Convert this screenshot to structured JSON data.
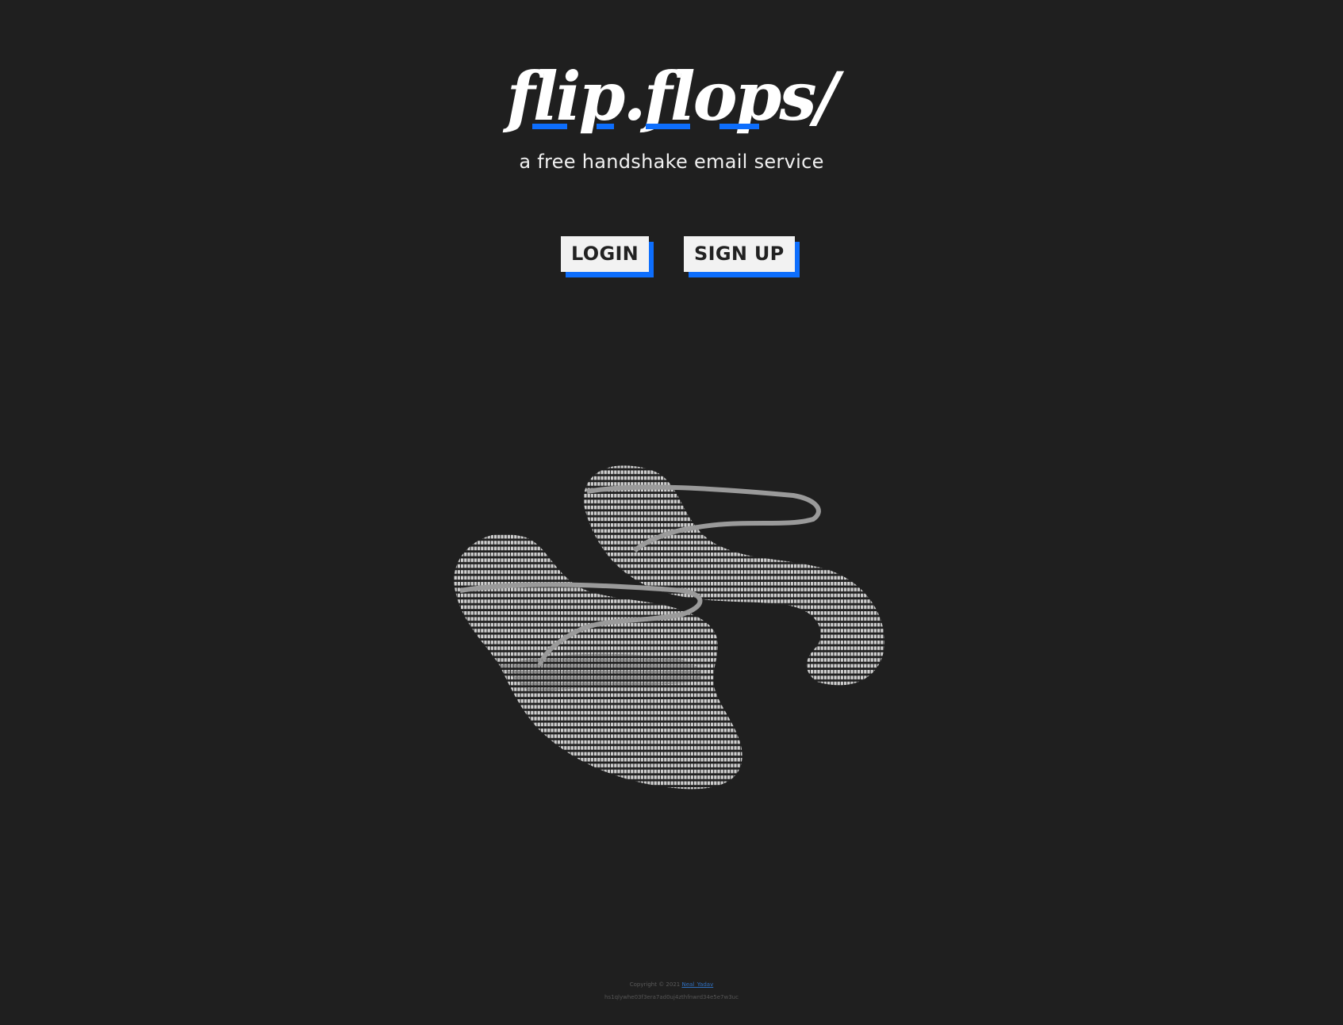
{
  "header": {
    "logo_text": "flip.flops/",
    "tagline": "a free handshake email service"
  },
  "actions": {
    "login_label": "LOGIN",
    "signup_label": "SIGN UP"
  },
  "illustration": {
    "icon": "flip-flops-ascii-art"
  },
  "footer": {
    "copyright_prefix": "Copyright © 2021",
    "author_link": "Neal_Yadav",
    "hash": "hs1qlywhe03f3era7ad0uj4zthfnwrd34e5e7w3uc"
  },
  "colors": {
    "background": "#1f1f1f",
    "accent": "#0d6efd",
    "button_bg": "#f2f2f2",
    "link": "#2f6fbf"
  }
}
